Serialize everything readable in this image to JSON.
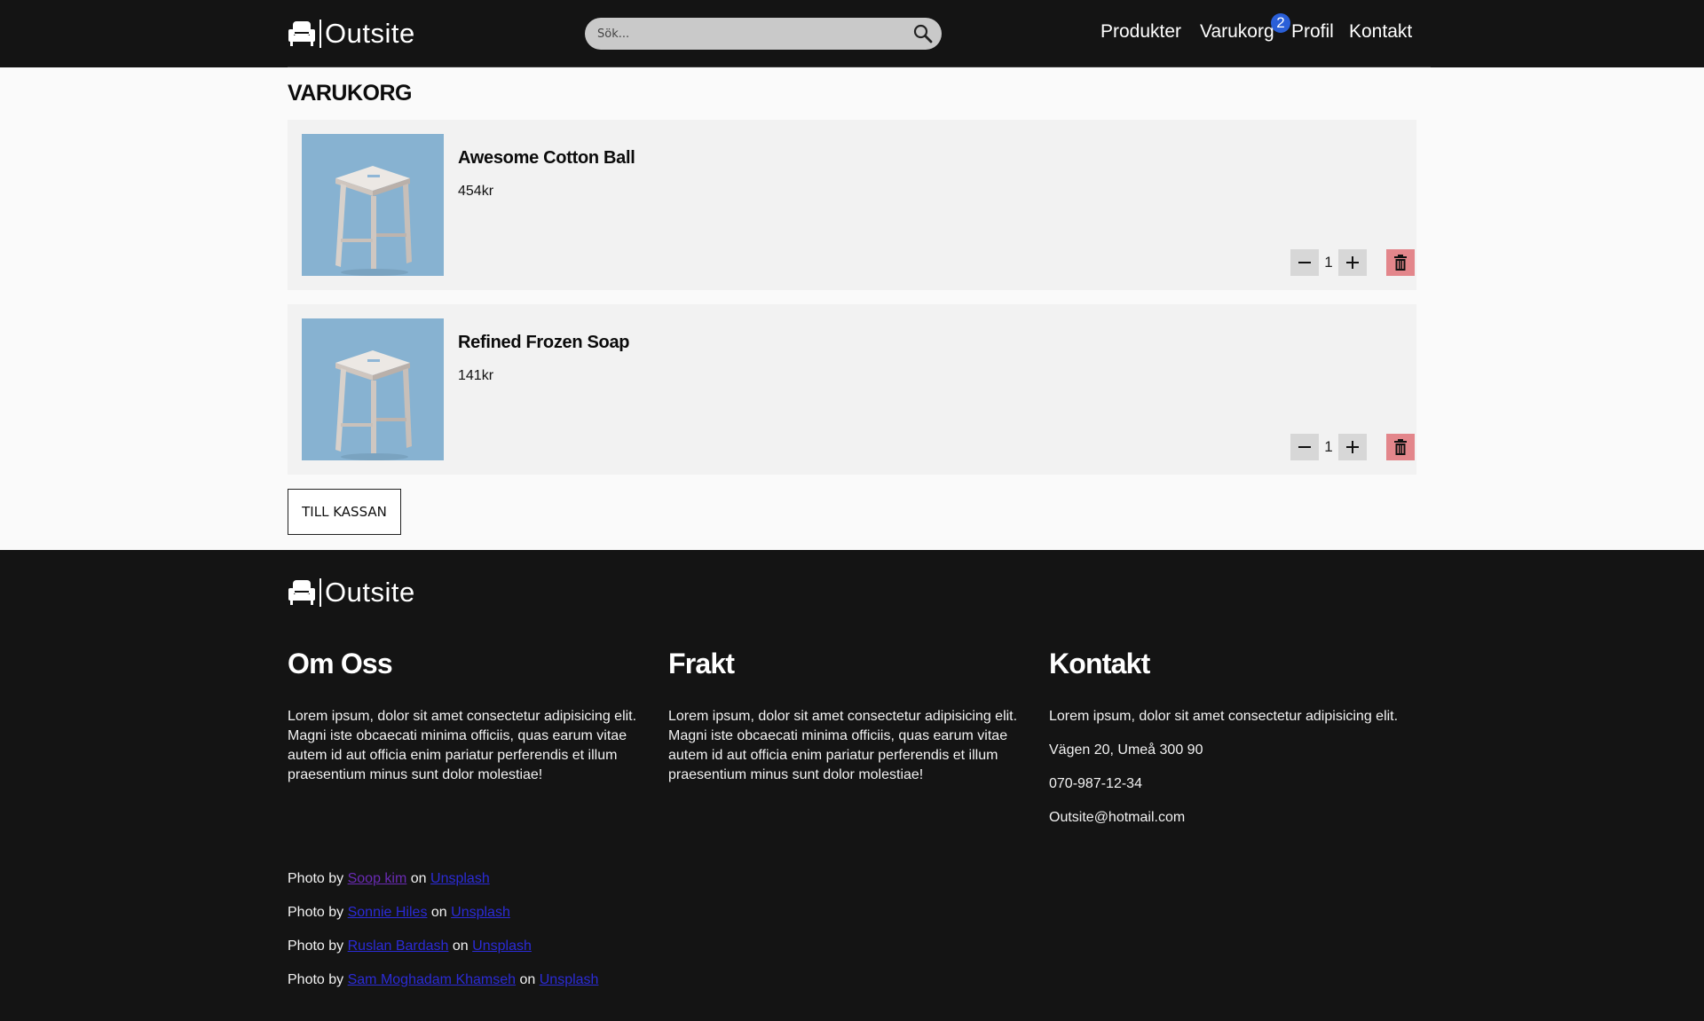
{
  "header": {
    "brand": "Outsite",
    "search_placeholder": "Sök...",
    "nav": [
      "Produkter",
      "Varukorg",
      "Profil",
      "Kontakt"
    ],
    "cart_count": "2"
  },
  "main": {
    "title": "VARUKORG",
    "items": [
      {
        "name": "Awesome Cotton Ball",
        "price": "454kr",
        "quantity": "1"
      },
      {
        "name": "Refined Frozen Soap",
        "price": "141kr",
        "quantity": "1"
      }
    ],
    "checkout_label": "TILL KASSAN"
  },
  "footer": {
    "brand": "Outsite",
    "about": {
      "heading": "Om Oss",
      "text": "Lorem ipsum, dolor sit amet consectetur adipisicing elit. Magni iste obcaecati minima officiis, quas earum vitae autem id aut officia enim pariatur perferendis et illum praesentium minus sunt dolor molestiae!"
    },
    "shipping": {
      "heading": "Frakt",
      "text": "Lorem ipsum, dolor sit amet consectetur adipisicing elit. Magni iste obcaecati minima officiis, quas earum vitae autem id aut officia enim pariatur perferendis et illum praesentium minus sunt dolor molestiae!"
    },
    "contact": {
      "heading": "Kontakt",
      "text": "Lorem ipsum, dolor sit amet consectetur adipisicing elit.",
      "address": "Vägen 20, Umeå 300 90",
      "phone": "070-987-12-34",
      "email": "Outsite@hotmail.com"
    },
    "credits": [
      {
        "prefix": "Photo by",
        "author": "Soop kim",
        "on": "on",
        "site": "Unsplash"
      },
      {
        "prefix": "Photo by",
        "author": "Sonnie Hiles",
        "on": "on",
        "site": "Unsplash"
      },
      {
        "prefix": "Photo by",
        "author": "Ruslan Bardash",
        "on": "on",
        "site": "Unsplash"
      },
      {
        "prefix": "Photo by",
        "author": "Sam Moghadam Khamseh",
        "on": "on",
        "site": "Unsplash"
      }
    ]
  },
  "colors": {
    "header_bg": "#141414",
    "badge": "#2a5fd8",
    "delete_button": "#e3868b",
    "card_bg": "#f2f2f2",
    "link": "#2b2bd6",
    "visited_link": "#6a2bb4"
  }
}
